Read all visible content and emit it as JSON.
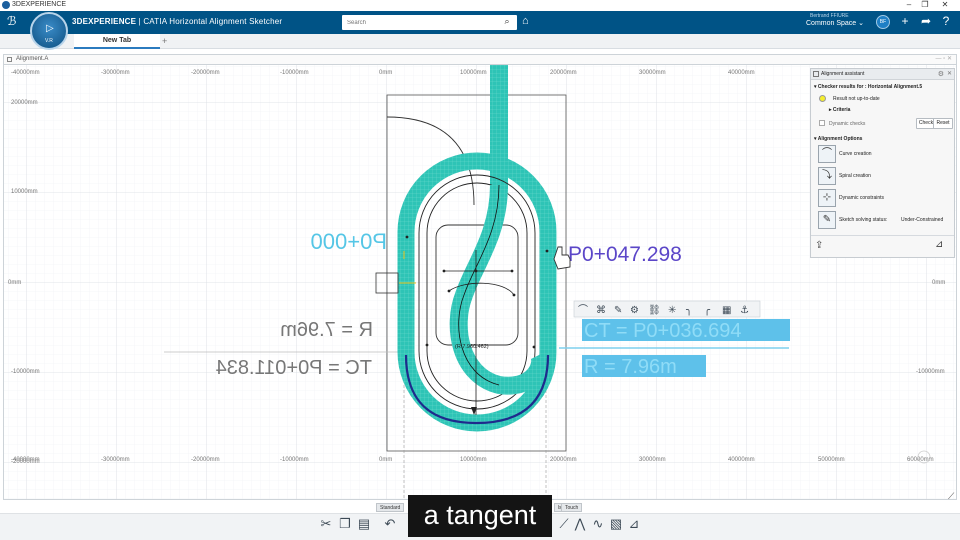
{
  "os": {
    "title": "3DEXPERIENCE",
    "controls": [
      "–",
      "❐",
      "✕"
    ]
  },
  "topbar": {
    "brand_prefix": "3DEXPERIENCE",
    "brand_suffix": " | CATIA  Horizontal Alignment Sketcher",
    "search_placeholder": "Search",
    "user_name": "Bertrand FFIURE",
    "space": "Common Space ⌄",
    "avatar_initials": "BF"
  },
  "compass": {
    "version": "V.R"
  },
  "tabs": {
    "active": "New Tab",
    "add": "+"
  },
  "window": {
    "title": "Alignment.A"
  },
  "viewport": {
    "x_ticks": [
      "-40000mm",
      "-30000mm",
      "-20000mm",
      "-10000mm",
      "0mm",
      "10000mm",
      "20000mm",
      "30000mm",
      "40000mm"
    ],
    "x_ticks_bottom": [
      "-40000mm",
      "-30000mm",
      "-20000mm",
      "-10000mm",
      "0mm",
      "10000mm",
      "20000mm",
      "30000mm",
      "40000mm",
      "50000mm",
      "60000mm"
    ],
    "y_ticks": [
      "20000mm",
      "10000mm",
      "0mm",
      "-10000mm",
      "-20000mm"
    ],
    "y_right": [
      "0mm",
      "-10000mm"
    ],
    "labels": {
      "p0_000": "P0+000",
      "p0_047": "P0+047.298",
      "r_mirror": "R = 7.96m",
      "tc_mirror": "TC = P0+011.834",
      "ct": "CT = P0+036.694",
      "r": "R = 7.96m",
      "small": "(R 7.960.462)"
    },
    "colors": {
      "teal": "#2ec4b6",
      "blue_text": "#5b46c8",
      "cyan_text": "#55c6e6",
      "highlight": "#4fb8e6",
      "navy": "#1e2a8c"
    }
  },
  "panel": {
    "title": "Alignment assistant",
    "checker_header": "Checker results for : Horizontal Alignment.5",
    "result": "Result not up-to-date",
    "criteria": "Criteria",
    "dynamic_checks": "Dynamic checks",
    "check_btn": "Check",
    "reset_btn": "Reset",
    "options_header": "Alignment Options",
    "options": [
      "Curve creation",
      "Spiral creation",
      "Dynamic constraints",
      "Sketch solving status:"
    ],
    "solving_status": "Under-Constrained"
  },
  "bottom": {
    "tab_standard": "Standard",
    "tab_tools": "ls",
    "tab_touch": "Touch"
  },
  "caption": "a tangent"
}
